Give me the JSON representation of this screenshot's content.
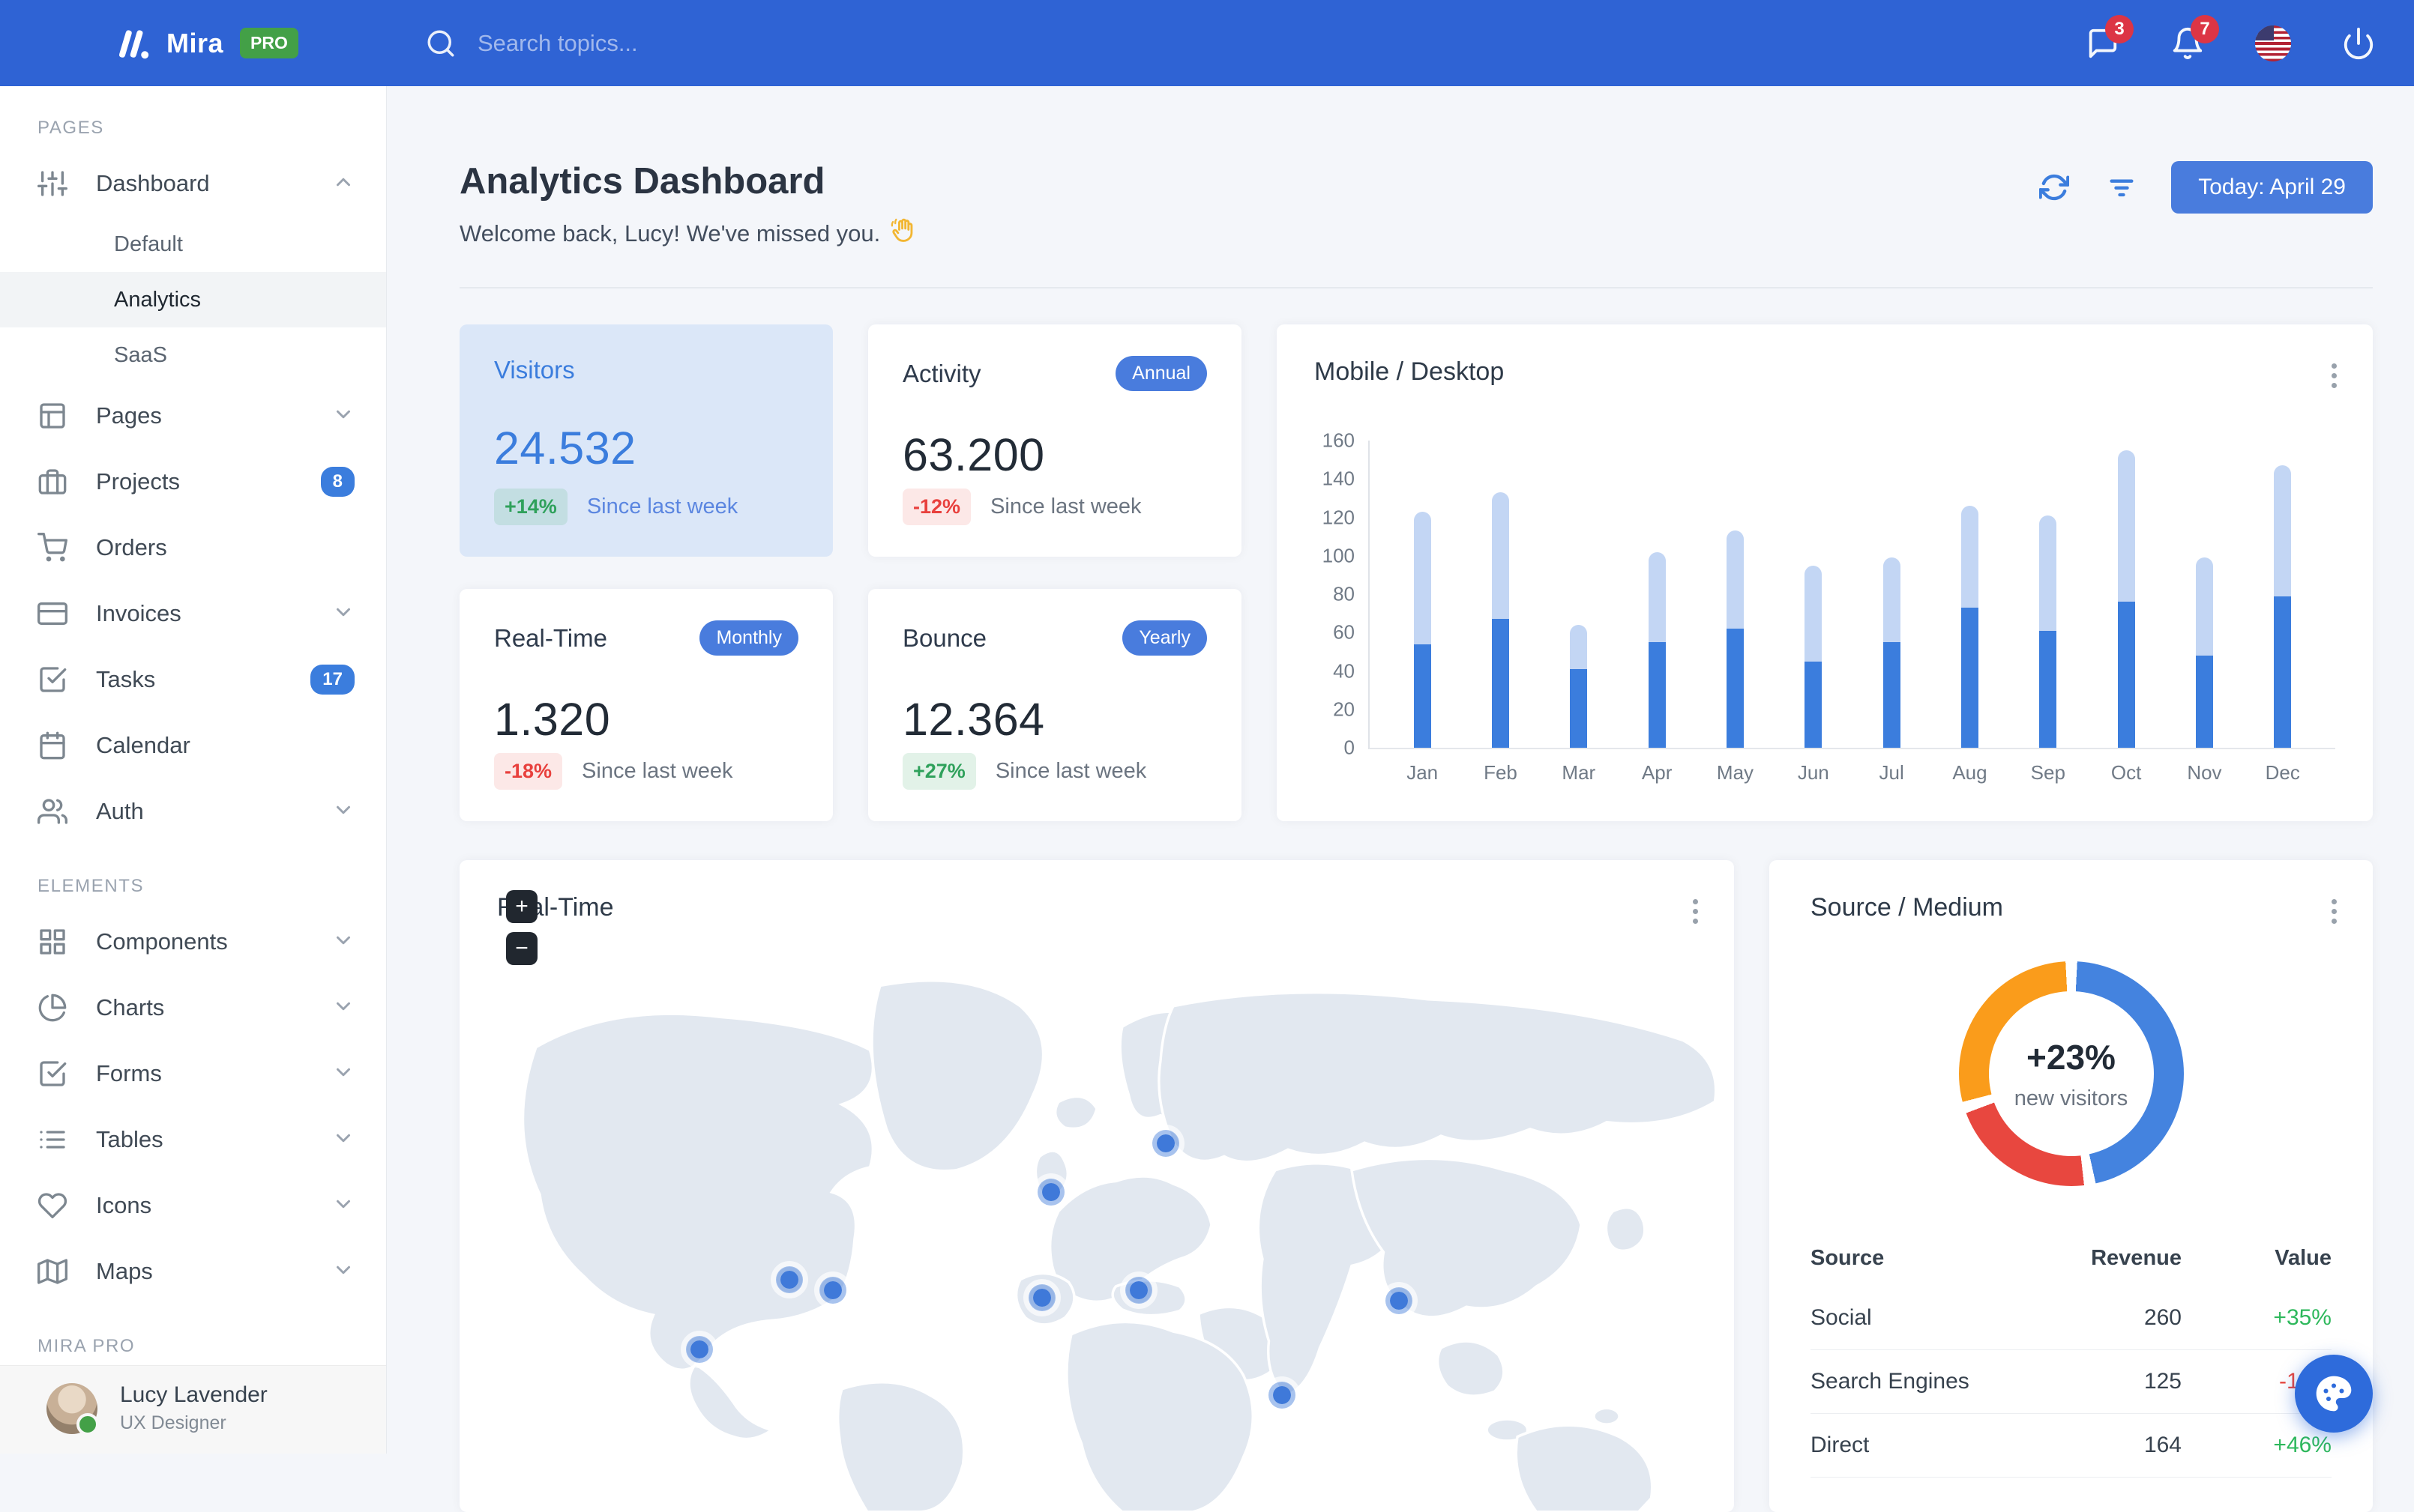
{
  "navbar": {
    "brand": "Mira",
    "brand_badge": "PRO",
    "search_placeholder": "Search topics...",
    "messages_badge": "3",
    "alerts_badge": "7"
  },
  "sidebar": {
    "sections": [
      {
        "label": "PAGES",
        "items": [
          {
            "label": "Dashboard",
            "icon": "sliders-icon",
            "expand": "up",
            "children": [
              {
                "label": "Default",
                "active": false
              },
              {
                "label": "Analytics",
                "active": true
              },
              {
                "label": "SaaS",
                "active": false
              }
            ]
          },
          {
            "label": "Pages",
            "icon": "layout-icon",
            "expand": "down"
          },
          {
            "label": "Projects",
            "icon": "briefcase-icon",
            "badge": "8"
          },
          {
            "label": "Orders",
            "icon": "cart-icon"
          },
          {
            "label": "Invoices",
            "icon": "credit-card-icon",
            "expand": "down"
          },
          {
            "label": "Tasks",
            "icon": "check-square-icon",
            "badge": "17"
          },
          {
            "label": "Calendar",
            "icon": "calendar-icon"
          },
          {
            "label": "Auth",
            "icon": "users-icon",
            "expand": "down"
          }
        ]
      },
      {
        "label": "ELEMENTS",
        "items": [
          {
            "label": "Components",
            "icon": "grid-icon",
            "expand": "down"
          },
          {
            "label": "Charts",
            "icon": "pie-chart-icon",
            "expand": "down"
          },
          {
            "label": "Forms",
            "icon": "check-square-icon",
            "expand": "down"
          },
          {
            "label": "Tables",
            "icon": "list-icon",
            "expand": "down"
          },
          {
            "label": "Icons",
            "icon": "heart-icon",
            "expand": "down"
          },
          {
            "label": "Maps",
            "icon": "map-icon",
            "expand": "down"
          }
        ]
      },
      {
        "label": "MIRA PRO",
        "items": []
      }
    ],
    "user": {
      "name": "Lucy Lavender",
      "role": "UX Designer"
    }
  },
  "header": {
    "title": "Analytics Dashboard",
    "subtitle": "Welcome back, Lucy! We've missed you.",
    "wave_emoji": "👋",
    "today_button": "Today: April 29"
  },
  "stats": [
    {
      "title": "Visitors",
      "value": "24.532",
      "delta": "+14%",
      "delta_dir": "up",
      "note": "Since last week",
      "variant": "primary"
    },
    {
      "title": "Activity",
      "value": "63.200",
      "delta": "-12%",
      "delta_dir": "down",
      "note": "Since last week",
      "badge": "Annual"
    },
    {
      "title": "Real-Time",
      "value": "1.320",
      "delta": "-18%",
      "delta_dir": "down",
      "note": "Since last week",
      "badge": "Monthly"
    },
    {
      "title": "Bounce",
      "value": "12.364",
      "delta": "+27%",
      "delta_dir": "up",
      "note": "Since last week",
      "badge": "Yearly"
    }
  ],
  "chart_data": [
    {
      "type": "bar",
      "title": "Mobile / Desktop",
      "stacked": true,
      "categories": [
        "Jan",
        "Feb",
        "Mar",
        "Apr",
        "May",
        "Jun",
        "Jul",
        "Aug",
        "Sep",
        "Oct",
        "Nov",
        "Dec"
      ],
      "series": [
        {
          "name": "Mobile",
          "color": "#3b7ddd",
          "values": [
            54,
            67,
            41,
            55,
            62,
            45,
            55,
            73,
            61,
            76,
            48,
            79
          ]
        },
        {
          "name": "Desktop",
          "color": "#c3d6f4",
          "values": [
            69,
            66,
            23,
            47,
            51,
            50,
            44,
            53,
            60,
            79,
            51,
            68
          ]
        }
      ],
      "ylim": [
        0,
        160
      ],
      "yticks": [
        0,
        20,
        40,
        60,
        80,
        100,
        120,
        140,
        160
      ],
      "grid": false,
      "legend": "none"
    },
    {
      "type": "pie",
      "title": "Source / Medium",
      "center_value": "+23%",
      "center_label": "new visitors",
      "slices": [
        {
          "label": "Social",
          "value": 260,
          "color": "#4483df"
        },
        {
          "label": "Search Engines",
          "value": 125,
          "color": "#e8473f"
        },
        {
          "label": "Direct",
          "value": 164,
          "color": "#fa9c1b"
        }
      ],
      "legend": "none"
    }
  ],
  "map_card": {
    "title": "Real-Time",
    "zoom_in": "+",
    "zoom_out": "−",
    "markers": [
      {
        "name": "california",
        "x": 18.8,
        "y": 70.3
      },
      {
        "name": "midwest-us",
        "x": 25.9,
        "y": 57.6
      },
      {
        "name": "northeast-us",
        "x": 29.3,
        "y": 59.4
      },
      {
        "name": "london",
        "x": 46.4,
        "y": 41.5
      },
      {
        "name": "spain",
        "x": 45.7,
        "y": 60.8
      },
      {
        "name": "turkey",
        "x": 53.3,
        "y": 59.4
      },
      {
        "name": "moscow",
        "x": 55.4,
        "y": 32.6
      },
      {
        "name": "india",
        "x": 64.5,
        "y": 78.6
      },
      {
        "name": "china",
        "x": 73.7,
        "y": 61.4
      }
    ]
  },
  "source_table": {
    "headers": [
      "Source",
      "Revenue",
      "Value"
    ],
    "rows": [
      {
        "source": "Social",
        "revenue": "260",
        "value": "+35%",
        "dir": "up"
      },
      {
        "source": "Search Engines",
        "revenue": "125",
        "value": "-12%",
        "dir": "down"
      },
      {
        "source": "Direct",
        "revenue": "164",
        "value": "+46%",
        "dir": "up"
      }
    ]
  },
  "colors": {
    "navbar": "#2f63d4",
    "primary": "#3b7ddd",
    "primary_light_bar": "#c3d6f4",
    "visitors_card_bg": "#dbe7f8",
    "badge_red": "#dc3545",
    "pro_green": "#43a047",
    "success": "#2eb85c",
    "danger": "#e8453c",
    "donut_blue": "#4483df",
    "donut_red": "#e8473f",
    "donut_orange": "#fa9c1b",
    "map_land": "#e2e8f0",
    "content_bg": "#f4f6fa"
  }
}
